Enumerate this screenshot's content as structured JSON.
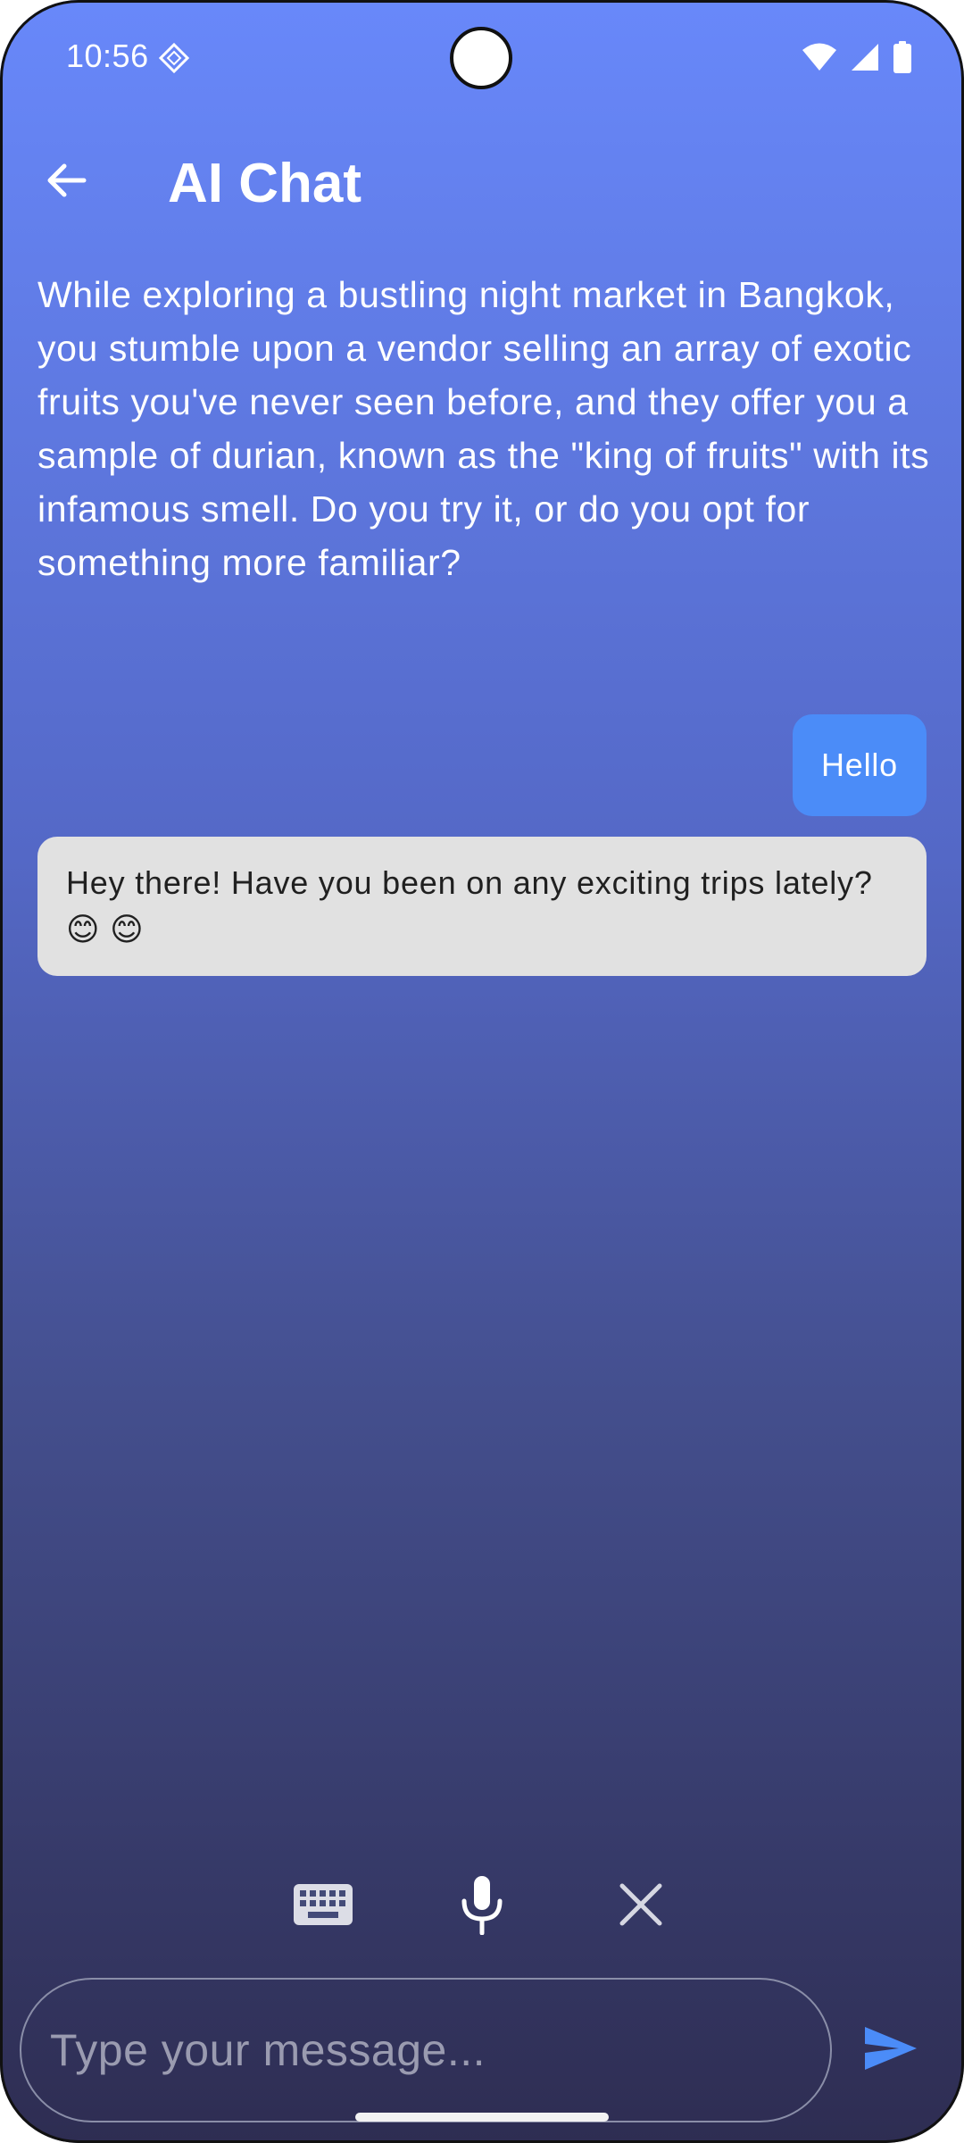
{
  "status_bar": {
    "time": "10:56",
    "icons": [
      "diamond-notification-icon",
      "wifi-icon",
      "cellular-signal-icon",
      "battery-icon"
    ]
  },
  "app_bar": {
    "back_icon": "arrow-left-icon",
    "title": "AI Chat"
  },
  "prompt": {
    "text": "While exploring a bustling night market in Bangkok, you stumble upon a vendor selling an array of exotic fruits you've never seen before, and they offer you a sample of durian, known as the \"king of fruits\" with its infamous smell. Do you try it, or do you opt for something more familiar?"
  },
  "messages": [
    {
      "sender": "user",
      "text": "Hello"
    },
    {
      "sender": "ai",
      "text": "Hey there! Have you been on any exciting trips lately? 😊 😊"
    }
  ],
  "input_controls": {
    "keyboard_icon": "keyboard-icon",
    "mic_icon": "microphone-icon",
    "close_icon": "close-icon"
  },
  "composer": {
    "placeholder": "Type your message...",
    "value": "",
    "send_icon": "send-icon"
  },
  "colors": {
    "gradient_top": "#6888fa",
    "gradient_bottom": "#2e2d52",
    "user_bubble": "#4b8cf8",
    "ai_bubble": "#e1e1e1",
    "send_accent": "#4b8cf8"
  }
}
